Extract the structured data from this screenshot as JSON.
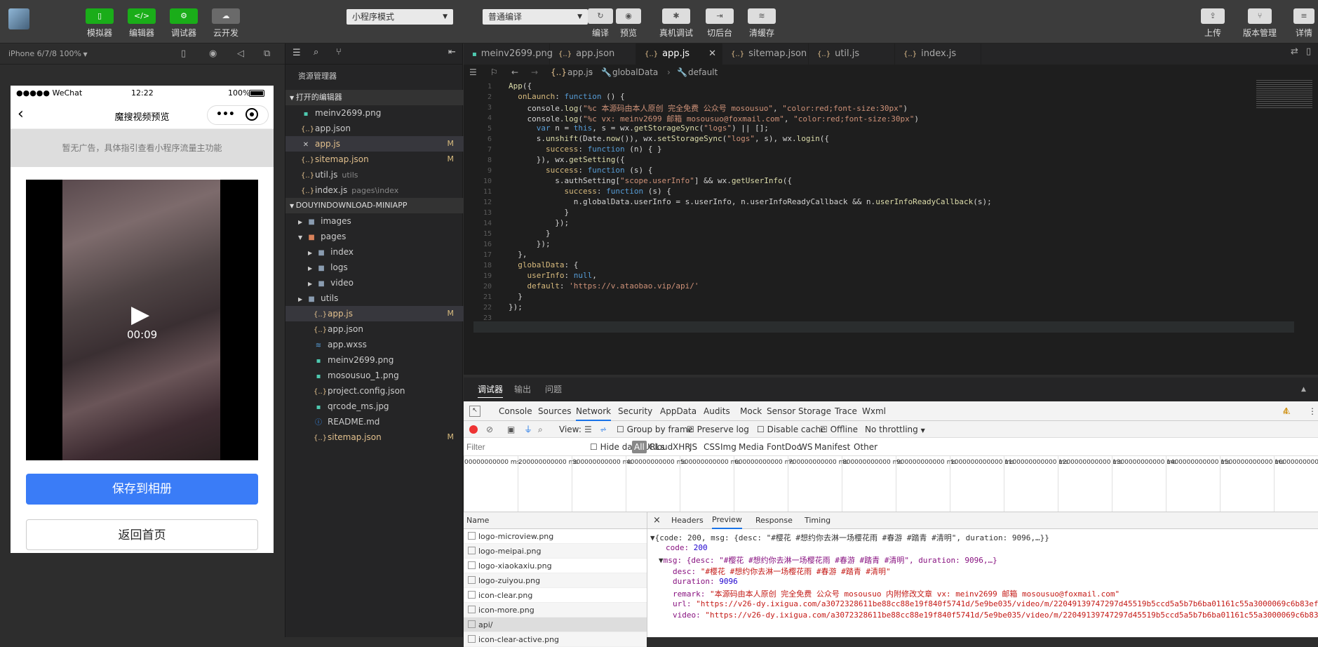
{
  "toolbar": {
    "simulator": "模拟器",
    "editor": "编辑器",
    "debugger": "调试器",
    "cloud": "云开发",
    "mode_select": "小程序模式",
    "compile_select": "普通编译",
    "compile": "编译",
    "preview": "预览",
    "device_debug": "真机调试",
    "switch_bg": "切后台",
    "clear_cache": "清缓存",
    "upload": "上传",
    "version": "版本管理",
    "details": "详情"
  },
  "simulator": {
    "device": "iPhone 6/7/8 100%",
    "status": {
      "carrier": "●●●●● WeChat",
      "time": "12:22",
      "battery": "100%"
    },
    "nav_title": "魔搜视频预览",
    "nav_dots": "•••",
    "ad_text": "暂无广告，具体指引查看小程序流量主功能",
    "video_time": "00:09",
    "save_button": "保存到相册",
    "home_button": "返回首页"
  },
  "explorer": {
    "title": "资源管理器",
    "open_editors": "打开的编辑器",
    "open_files": [
      {
        "name": "meinv2699.png",
        "icon": "image",
        "mod": ""
      },
      {
        "name": "app.json",
        "icon": "json",
        "mod": ""
      },
      {
        "name": "app.js",
        "icon": "close",
        "mod": "M"
      },
      {
        "name": "sitemap.json",
        "icon": "json",
        "mod": "M"
      },
      {
        "name": "util.js",
        "icon": "json",
        "mod": "",
        "sub": "utils"
      },
      {
        "name": "index.js",
        "icon": "json",
        "mod": "",
        "sub": "pages\\index"
      }
    ],
    "project": "DOUYINDOWNLOAD-MINIAPP",
    "tree": [
      {
        "name": "images",
        "type": "folder"
      },
      {
        "name": "pages",
        "type": "folder-open"
      },
      {
        "name": "index",
        "type": "folder"
      },
      {
        "name": "logs",
        "type": "folder"
      },
      {
        "name": "video",
        "type": "folder"
      },
      {
        "name": "utils",
        "type": "folder"
      },
      {
        "name": "app.js",
        "type": "js",
        "mod": "M"
      },
      {
        "name": "app.json",
        "type": "json"
      },
      {
        "name": "app.wxss",
        "type": "wxss"
      },
      {
        "name": "meinv2699.png",
        "type": "image"
      },
      {
        "name": "mosousuo_1.png",
        "type": "image"
      },
      {
        "name": "project.config.json",
        "type": "json"
      },
      {
        "name": "qrcode_ms.jpg",
        "type": "image"
      },
      {
        "name": "README.md",
        "type": "info"
      },
      {
        "name": "sitemap.json",
        "type": "json",
        "mod": "M"
      }
    ]
  },
  "tabs": [
    "meinv2699.png",
    "app.json",
    "app.js",
    "sitemap.json",
    "util.js",
    "index.js"
  ],
  "breadcrumb": {
    "file": "app.js",
    "p1": "globalData",
    "p2": "default"
  },
  "code": [
    "App({",
    "  onLaunch: function () {",
    "    console.log(\"%c 本源码由本人原创 完全免费 公众号 mosousuo\", \"color:red;font-size:30px\")",
    "    console.log(\"%c vx: meinv2699 邮箱 mosousuo@foxmail.com\", \"color:red;font-size:30px\")",
    "      var n = this, s = wx.getStorageSync(\"logs\") || [];",
    "      s.unshift(Date.now()), wx.setStorageSync(\"logs\", s), wx.login({",
    "        success: function (n) { }",
    "      }), wx.getSetting({",
    "        success: function (s) {",
    "          s.authSetting[\"scope.userInfo\"] && wx.getUserInfo({",
    "            success: function (s) {",
    "              n.globalData.userInfo = s.userInfo, n.userInfoReadyCallback && n.userInfoReadyCallback(s);",
    "            }",
    "          });",
    "        }",
    "      });",
    "  },",
    "  globalData: {",
    "    userInfo: null,",
    "    default: 'https://v.ataobao.vip/api/'",
    "  }",
    "});",
    ""
  ],
  "devtools": {
    "head_tabs": [
      "调试器",
      "输出",
      "问题"
    ],
    "tabs": [
      "Console",
      "Sources",
      "Network",
      "Security",
      "AppData",
      "Audits",
      "Mock",
      "Sensor",
      "Storage",
      "Trace",
      "Wxml"
    ],
    "warn_count": "4",
    "view": "View:",
    "group_by_frame": "Group by frame",
    "preserve_log": "Preserve log",
    "disable_cache": "Disable cache",
    "offline": "Offline",
    "throttling": "No throttling",
    "filter_placeholder": "Filter",
    "hide_data_urls": "Hide data URLs",
    "filter_types": [
      "All",
      "Cloud",
      "XHR",
      "JS",
      "CSS",
      "Img",
      "Media",
      "Font",
      "Doc",
      "WS",
      "Manifest",
      "Other"
    ],
    "timeline_labels": [
      "00000000000 ms",
      "200000000000 ms",
      "300000000000 ms",
      "400000000000 ms",
      "500000000000 ms",
      "600000000000 ms",
      "700000000000 ms",
      "800000000000 ms",
      "900000000000 ms",
      "1000000000000 ms",
      "1100000000000 ms",
      "1200000000000 ms",
      "1300000000000 ms",
      "1400000000000 ms",
      "1500000000000 ms",
      "1600000000000 ms"
    ],
    "name_header": "Name",
    "requests": [
      "logo-microview.png",
      "logo-meipai.png",
      "logo-xiaokaxiu.png",
      "logo-zuiyou.png",
      "icon-clear.png",
      "icon-more.png",
      "api/",
      "icon-clear-active.png"
    ],
    "detail_tabs": [
      "Headers",
      "Preview",
      "Response",
      "Timing"
    ],
    "preview": {
      "line1": "{code: 200, msg: {desc: \"#樱花 #想约你去淋一场樱花雨 #春游 #踏青 #清明\", duration: 9096,…}}",
      "code_key": "code:",
      "code_val": "200",
      "msg_line": "msg: {desc: \"#樱花 #想约你去淋一场樱花雨 #春游 #踏青 #清明\", duration: 9096,…}",
      "desc_key": "desc:",
      "desc_val": "\"#樱花 #想约你去淋一场樱花雨 #春游 #踏青 #清明\"",
      "duration_key": "duration:",
      "duration_val": "9096",
      "remark_key": "remark:",
      "remark_val": "\"本源码由本人原创 完全免费 公众号 mosousuo 内附修改文章 vx: meinv2699 邮箱 mosousuo@foxmail.com\"",
      "url_key": "url:",
      "url_val": "\"https://v26-dy.ixigua.com/a3072328611be88cc88e19f840f5741d/5e9be035/video/m/22049139747297d45519b5ccd5a5b7b6ba01161c55a3000069c6b83ef",
      "video_key": "video:",
      "video_val": "\"https://v26-dy.ixigua.com/a3072328611be88cc88e19f840f5741d/5e9be035/video/m/22049139747297d45519b5ccd5a5b7b6ba01161c55a3000069c6b83"
    }
  }
}
